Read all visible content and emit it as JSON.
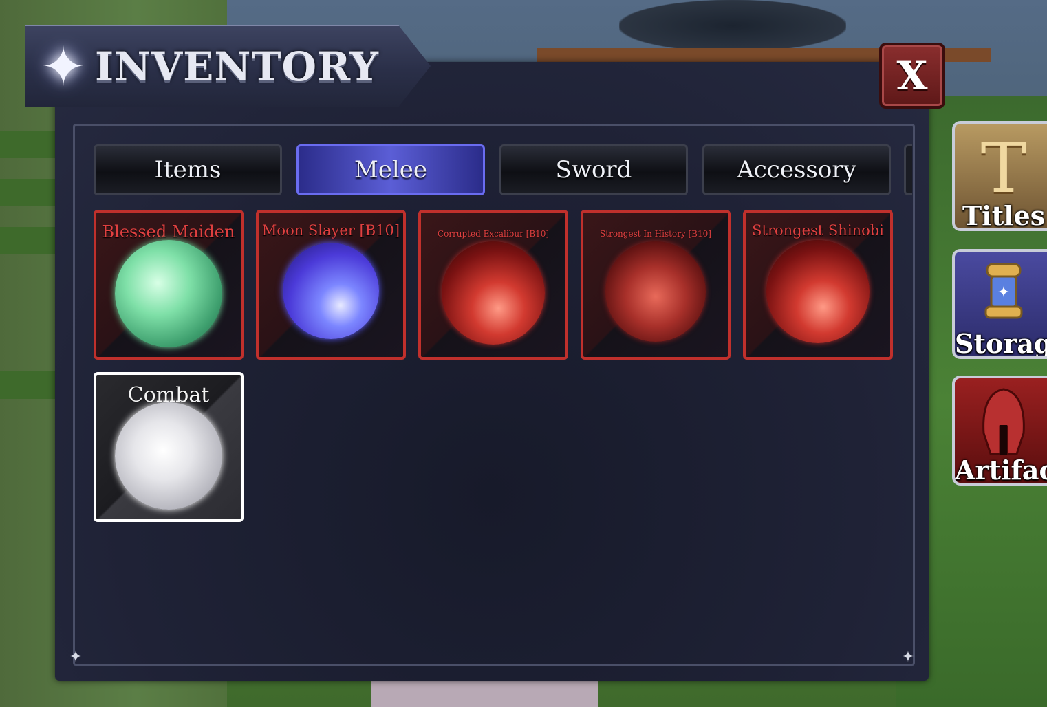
{
  "inventory": {
    "title": "INVENTORY",
    "close_label": "X",
    "tabs": [
      {
        "label": "Items",
        "active": false
      },
      {
        "label": "Melee",
        "active": true
      },
      {
        "label": "Sword",
        "active": false
      },
      {
        "label": "Accessory",
        "active": false
      }
    ],
    "items": [
      {
        "name": "Blessed Maiden",
        "rarity_color": "#c0302c",
        "orb": "green"
      },
      {
        "name": "Moon Slayer [B10]",
        "rarity_color": "#c0302c",
        "orb": "purple"
      },
      {
        "name": "Corrupted Excalibur [B10]",
        "rarity_color": "#c0302c",
        "orb": "red"
      },
      {
        "name": "Strongest In History [B10]",
        "rarity_color": "#c0302c",
        "orb": "red-cracked"
      },
      {
        "name": "Strongest Shinobi",
        "rarity_color": "#c0302c",
        "orb": "red"
      },
      {
        "name": "Combat",
        "rarity_color": "#ffffff",
        "orb": "white"
      }
    ]
  },
  "side_menu": [
    {
      "label": "Titles",
      "icon": "title-t-icon"
    },
    {
      "label": "Storage",
      "icon": "storage-capsule-icon"
    },
    {
      "label": "Artifact",
      "icon": "helmet-icon"
    }
  ],
  "colors": {
    "active_tab": "#5b5ed6",
    "rare_border": "#c0302c",
    "common_border": "#ffffff",
    "close_button": "#8a2e2e"
  }
}
